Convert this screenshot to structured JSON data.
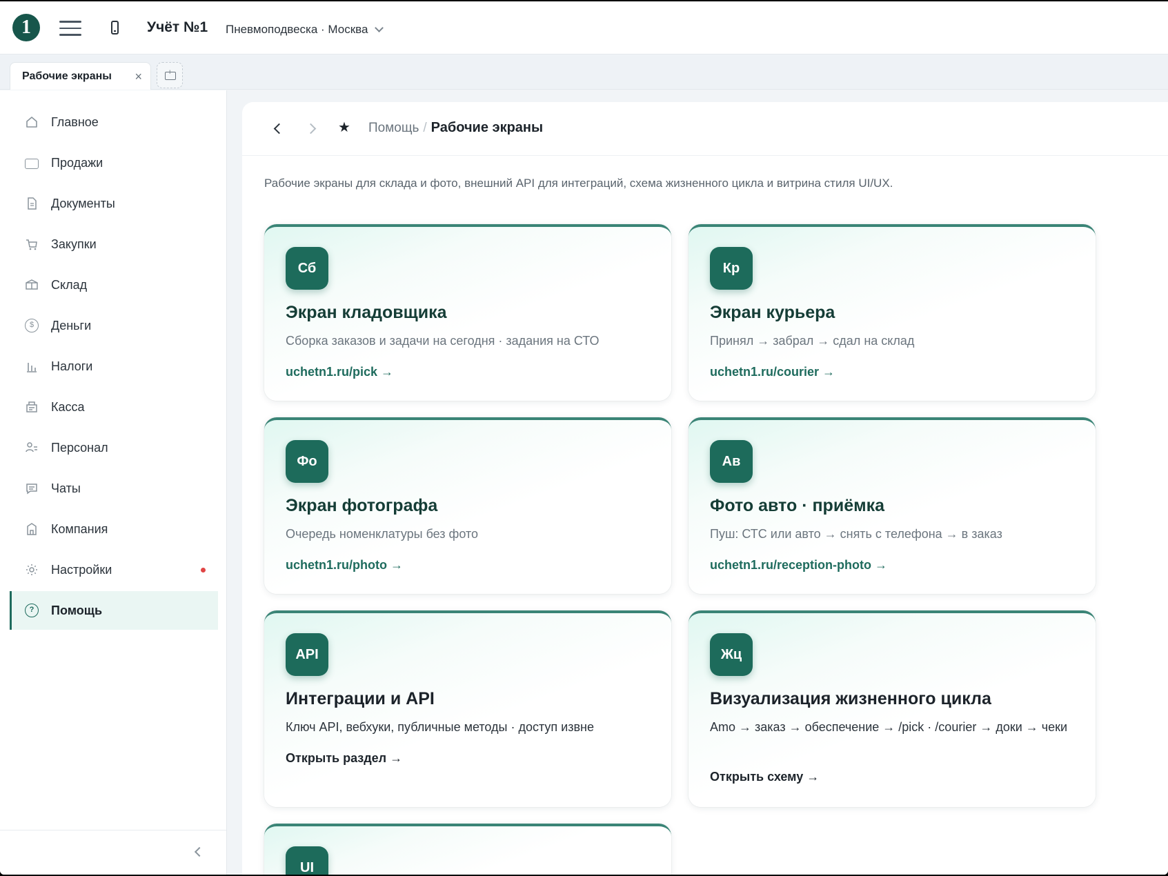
{
  "header": {
    "logo": "1",
    "app_title": "Учёт №1",
    "company": "Пневмоподвеска · Москва"
  },
  "tabs": [
    {
      "label": "Рабочие экраны",
      "close": "×"
    }
  ],
  "sidebar": {
    "items": [
      {
        "label": "Главное",
        "icon": "home-icon"
      },
      {
        "label": "Продажи",
        "icon": "sales-icon"
      },
      {
        "label": "Документы",
        "icon": "document-icon"
      },
      {
        "label": "Закупки",
        "icon": "cart-icon"
      },
      {
        "label": "Склад",
        "icon": "box-icon"
      },
      {
        "label": "Деньги",
        "icon": "money-icon"
      },
      {
        "label": "Налоги",
        "icon": "taxes-icon"
      },
      {
        "label": "Касса",
        "icon": "cashbox-icon"
      },
      {
        "label": "Персонал",
        "icon": "staff-icon"
      },
      {
        "label": "Чаты",
        "icon": "chat-icon"
      },
      {
        "label": "Компания",
        "icon": "company-icon"
      },
      {
        "label": "Настройки",
        "icon": "settings-icon",
        "has_notification": true
      },
      {
        "label": "Помощь",
        "icon": "help-icon",
        "active": true
      }
    ]
  },
  "breadcrumb": {
    "parent": "Помощь",
    "separator": "/",
    "current": "Рабочие экраны"
  },
  "intro": "Рабочие экраны для склада и фото, внешний API для интеграций, схема жизненного цикла и витрина стиля UI/UX.",
  "cards": [
    {
      "badge": "Сб",
      "title": "Экран кладовщика",
      "desc": "Сборка заказов и задачи на сегодня · задания на СТО",
      "link": "uchetn1.ru/pick →"
    },
    {
      "badge": "Кр",
      "title": "Экран курьера",
      "desc": "Принял → забрал → сдал на склад",
      "link": "uchetn1.ru/courier →"
    },
    {
      "badge": "Фо",
      "title": "Экран фотографа",
      "desc": "Очередь номенклатуры без фото",
      "link": "uchetn1.ru/photo →"
    },
    {
      "badge": "Ав",
      "title": "Фото авто · приёмка",
      "desc": "Пуш: СТС или авто → снять с телефона → в заказ",
      "link": "uchetn1.ru/reception-photo →"
    },
    {
      "badge": "API",
      "title": "Интеграции и API",
      "desc": "Ключ API, вебхуки, публичные методы · доступ извне",
      "link": "Открыть раздел →"
    },
    {
      "badge": "Жц",
      "title": "Визуализация жизненного цикла",
      "desc": "Amo → заказ → обеспечение → /pick · /courier → доки → чеки",
      "link": "Открыть схему →"
    },
    {
      "badge": "UI"
    }
  ],
  "colors": {
    "accent": "#1d6b5b",
    "accent_light": "#eaf6f3",
    "notification": "#e04545"
  }
}
